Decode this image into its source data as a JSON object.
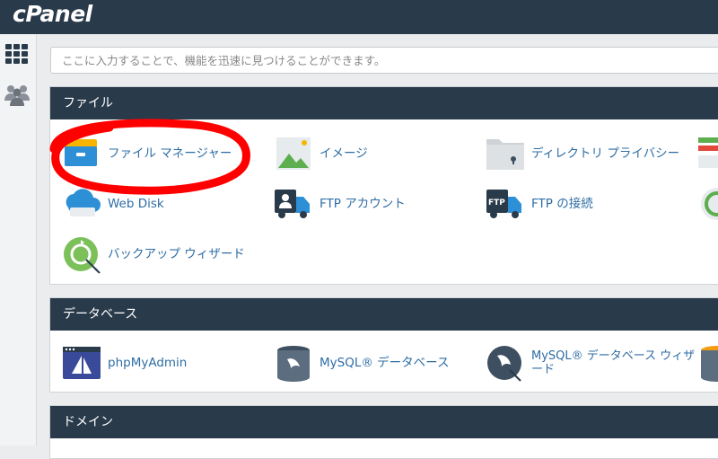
{
  "brand": {
    "logo_text": "cPanel"
  },
  "search": {
    "placeholder": "ここに入力することで、機能を迅速に見つけることができます。"
  },
  "sidebar": {
    "items": [
      {
        "icon": "grid-icon"
      },
      {
        "icon": "users-icon"
      }
    ]
  },
  "files": {
    "title": "ファイル",
    "items": [
      {
        "label": "ファイル マネージャー",
        "icon": "file-manager-icon"
      },
      {
        "label": "イメージ",
        "icon": "image-icon"
      },
      {
        "label": "ディレクトリ プライバシー",
        "icon": "directory-privacy-icon"
      },
      {
        "label": "Web Disk",
        "icon": "web-disk-icon"
      },
      {
        "label": "FTP アカウント",
        "icon": "ftp-accounts-icon"
      },
      {
        "label": "FTP の接続",
        "icon": "ftp-connections-icon"
      },
      {
        "label": "バックアップ ウィザード",
        "icon": "backup-wizard-icon"
      }
    ]
  },
  "databases": {
    "title": "データベース",
    "items": [
      {
        "label": "phpMyAdmin",
        "icon": "phpmyadmin-icon"
      },
      {
        "label": "MySQL® データベース",
        "icon": "mysql-databases-icon"
      },
      {
        "label_line1": "MySQL® データベース ウィザ",
        "label_line2": "ード",
        "icon": "mysql-wizard-icon"
      }
    ]
  },
  "domains": {
    "title": "ドメイン"
  },
  "colors": {
    "header_bg": "#293a4a",
    "link": "#2e6da4",
    "highlight_circle": "#ff0000"
  }
}
